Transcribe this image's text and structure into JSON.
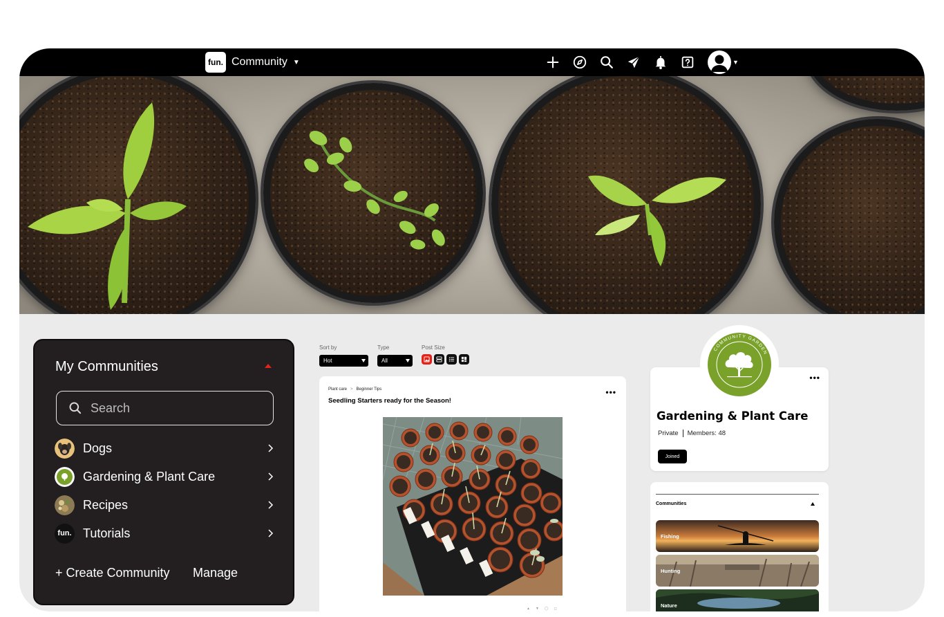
{
  "topbar": {
    "brand_logo": "fun.",
    "brand_name": "Community",
    "icons": [
      "plus-icon",
      "compass-icon",
      "search-icon",
      "send-icon",
      "bell-icon",
      "help-icon"
    ],
    "avatar_icon": "user-avatar-icon"
  },
  "hero": {
    "image": "seedling-pots-photo"
  },
  "my_communities": {
    "title": "My Communities",
    "search_placeholder": "Search",
    "items": [
      {
        "label": "Dogs",
        "avatar": "dog-avatar"
      },
      {
        "label": "Gardening & Plant Care",
        "avatar": "garden-avatar"
      },
      {
        "label": "Recipes",
        "avatar": "recipes-avatar"
      },
      {
        "label": "Tutorials",
        "avatar": "fun."
      }
    ],
    "create_label": "+ Create Community",
    "manage_label": "Manage"
  },
  "filters": {
    "sort_label": "Sort by",
    "sort_value": "Hot",
    "type_label": "Type",
    "type_value": "All",
    "size_label": "Post Size",
    "size_options": [
      "image-size-icon",
      "card-size-icon",
      "list-size-icon",
      "grid-size-icon"
    ]
  },
  "post": {
    "category": "Plant care",
    "subcategory": "Beginner Tips",
    "title": "Seedling Starters ready for the Season!",
    "image": "seedling-tray-photo"
  },
  "group": {
    "logo_text": "COMMUNITY GARDEN",
    "name": "Gardening & Plant Care",
    "privacy": "Private",
    "members": "Members: 48",
    "joined_label": "Joined",
    "brand_color": "#7aa22a"
  },
  "communities_panel": {
    "title": "Communities",
    "items": [
      "Fishing",
      "Hunting",
      "Nature"
    ]
  },
  "colors": {
    "accent": "#e2231a",
    "dark_panel": "#231f20",
    "background": "#ebebeb"
  }
}
